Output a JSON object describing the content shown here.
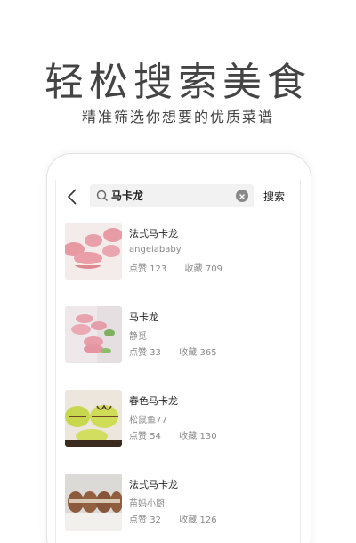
{
  "hero": {
    "title": "轻松搜索美食",
    "subtitle": "精准筛选你想要的优质菜谱"
  },
  "search": {
    "query": "马卡龙",
    "button_label": "搜索"
  },
  "results": [
    {
      "title": "法式马卡龙",
      "author": "angeiababy",
      "likes_label": "点赞",
      "likes": "123",
      "favs_label": "收藏",
      "favs": "709"
    },
    {
      "title": "马卡龙",
      "author": "静觅",
      "likes_label": "点赞",
      "likes": "33",
      "favs_label": "收藏",
      "favs": "365"
    },
    {
      "title": "春色马卡龙",
      "author": "松鼠鱼77",
      "likes_label": "点赞",
      "likes": "54",
      "favs_label": "收藏",
      "favs": "130"
    },
    {
      "title": "法式马卡龙",
      "author": "苗妈小厨",
      "likes_label": "点赞",
      "likes": "32",
      "favs_label": "收藏",
      "favs": "126"
    }
  ],
  "colors": {
    "background": "#ffffff",
    "search_box": "#f2f2f2",
    "text_primary": "#222222",
    "text_secondary": "#888888"
  }
}
